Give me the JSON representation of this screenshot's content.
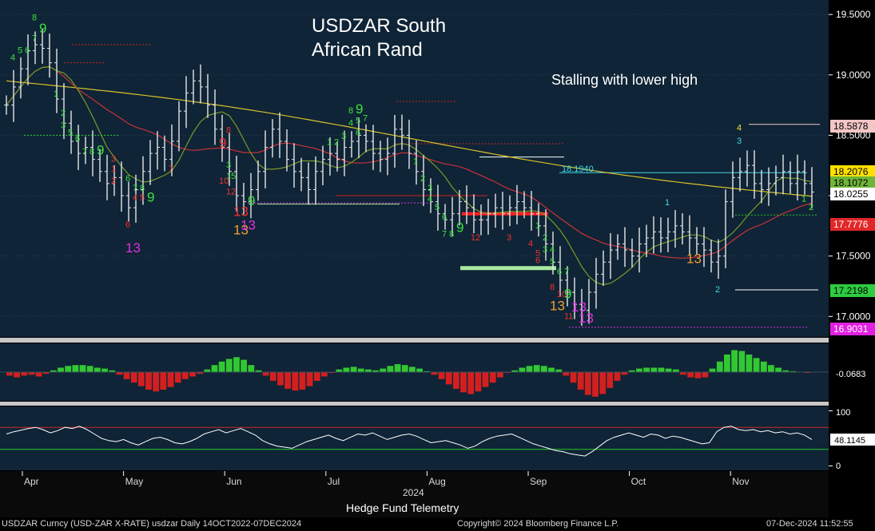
{
  "chart_data": {
    "type": "bar",
    "title": "USDZAR South African Rand",
    "title_lines": [
      "USDZAR South",
      "African Rand"
    ],
    "annotation": "Stalling with lower high",
    "price_level_label": "18.1940",
    "price_axis": {
      "ylim": [
        16.83,
        19.62
      ],
      "ticks": [
        "19.5000",
        "19.0000",
        "18.5000",
        "18.0000",
        "17.5000",
        "17.0000"
      ],
      "tick_values": [
        19.5,
        19.0,
        18.5,
        18.0,
        17.5,
        17.0
      ],
      "tags": [
        {
          "label": "18.5878",
          "value": 18.5878,
          "bg": "#f4c6c6",
          "fg": "#000000"
        },
        {
          "label": "18.2076",
          "value": 18.2076,
          "bg": "#ffe000",
          "fg": "#000000"
        },
        {
          "label": "18.1072",
          "value": 18.1072,
          "bg": "#6fb53a",
          "fg": "#000000"
        },
        {
          "label": "18.0255",
          "value": 18.0255,
          "bg": "#ffffff",
          "fg": "#000000"
        },
        {
          "label": "17.7776",
          "value": 17.7776,
          "bg": "#e02828",
          "fg": "#ffffff"
        },
        {
          "label": "17.2198",
          "value": 17.2198,
          "bg": "#2ecc40",
          "fg": "#000000"
        },
        {
          "label": "16.9031",
          "value": 16.9031,
          "bg": "#e020e0",
          "fg": "#ffffff"
        }
      ]
    },
    "macd": {
      "label": "-0.0683",
      "value": -0.0683,
      "histogram": [
        -0.04,
        -0.06,
        -0.04,
        -0.03,
        -0.05,
        -0.02,
        0.02,
        0.05,
        0.07,
        0.08,
        0.08,
        0.07,
        0.05,
        0.04,
        0.02,
        -0.03,
        -0.08,
        -0.12,
        -0.16,
        -0.2,
        -0.22,
        -0.2,
        -0.17,
        -0.12,
        -0.08,
        -0.05,
        -0.02,
        0.03,
        0.08,
        0.12,
        0.15,
        0.17,
        0.14,
        0.08,
        0.02,
        -0.04,
        -0.1,
        -0.15,
        -0.19,
        -0.21,
        -0.2,
        -0.16,
        -0.1,
        -0.05,
        -0.01,
        0.03,
        0.05,
        0.06,
        0.04,
        0.03,
        0.02,
        0.04,
        0.07,
        0.09,
        0.08,
        0.06,
        0.04,
        0.01,
        -0.03,
        -0.08,
        -0.14,
        -0.19,
        -0.23,
        -0.25,
        -0.22,
        -0.17,
        -0.12,
        -0.06,
        -0.01,
        0.02,
        0.05,
        0.07,
        0.08,
        0.07,
        0.05,
        0.03,
        -0.04,
        -0.12,
        -0.2,
        -0.26,
        -0.28,
        -0.25,
        -0.18,
        -0.1,
        -0.03,
        0.02,
        0.04,
        0.05,
        0.05,
        0.05,
        0.04,
        0.03,
        -0.03,
        -0.06,
        -0.07,
        -0.06,
        0.04,
        0.12,
        0.2,
        0.25,
        0.24,
        0.2,
        0.16,
        0.12,
        0.08,
        0.05,
        0.02,
        0.01,
        0.0,
        -0.01
      ]
    },
    "rsi": {
      "label": "48.1145",
      "value": 48.1145,
      "ylim": [
        -8,
        108
      ],
      "ticks": [
        "100",
        "0"
      ],
      "tick_values": [
        100,
        0
      ],
      "upper": 70,
      "lower": 30,
      "values": [
        58,
        62,
        65,
        68,
        70,
        66,
        60,
        64,
        70,
        68,
        72,
        66,
        58,
        50,
        46,
        44,
        48,
        42,
        38,
        44,
        50,
        52,
        48,
        42,
        40,
        44,
        50,
        58,
        62,
        66,
        60,
        64,
        68,
        62,
        56,
        46,
        40,
        36,
        34,
        32,
        38,
        44,
        48,
        52,
        56,
        50,
        46,
        52,
        58,
        56,
        60,
        54,
        48,
        52,
        56,
        58,
        54,
        48,
        42,
        44,
        46,
        42,
        38,
        32,
        36,
        44,
        50,
        54,
        56,
        58,
        52,
        46,
        40,
        36,
        32,
        28,
        26,
        22,
        20,
        18,
        26,
        36,
        46,
        52,
        56,
        60,
        56,
        52,
        58,
        56,
        50,
        54,
        52,
        48,
        44,
        40,
        42,
        62,
        70,
        72,
        66,
        64,
        66,
        62,
        64,
        60,
        62,
        58,
        60,
        56,
        48
      ]
    },
    "x_axis": {
      "months": [
        "Apr",
        "May",
        "Jun",
        "Jul",
        "Aug",
        "Sep",
        "Oct",
        "Nov"
      ],
      "year": "2024"
    },
    "colors": {
      "panel_bg": "#0f2436",
      "axis_bg": "#000000",
      "price_bars": "#e6e6e6",
      "ma_yellow": "#d8c12a",
      "ma_red": "#c8323a",
      "ma_green": "#7a9a2a",
      "macd_pos": "#32c832",
      "macd_neg": "#d22020",
      "rsi_line": "#ffffff",
      "rsi_upper": "#c82828",
      "rsi_lower": "#28c828",
      "count_green": "#3ee03e",
      "count_red": "#f03030",
      "count_orange": "#f0a030",
      "count_magenta": "#e030e0",
      "count_cyan": "#40d8e8",
      "count_yellow": "#f0e040"
    },
    "td_counts": [
      {
        "t": "8",
        "i": 4,
        "v": 19.45,
        "c": "green"
      },
      {
        "t": "9",
        "i": 5,
        "v": 19.35,
        "c": "green"
      },
      {
        "t": "7",
        "i": 4,
        "v": 19.28,
        "c": "green"
      },
      {
        "t": "6",
        "i": 3,
        "v": 19.18,
        "c": "green"
      },
      {
        "t": "5",
        "i": 2,
        "v": 19.18,
        "c": "green"
      },
      {
        "t": "4",
        "i": 1,
        "v": 19.12,
        "c": "green"
      },
      {
        "t": "1",
        "i": 7,
        "v": 18.82,
        "c": "green"
      },
      {
        "t": "2",
        "i": 8,
        "v": 18.66,
        "c": "green"
      },
      {
        "t": "3",
        "i": 8,
        "v": 18.56,
        "c": "green"
      },
      {
        "t": "5",
        "i": 9,
        "v": 18.5,
        "c": "green"
      },
      {
        "t": "6",
        "i": 10,
        "v": 18.45,
        "c": "green"
      },
      {
        "t": "7",
        "i": 11,
        "v": 18.34,
        "c": "green"
      },
      {
        "t": "8",
        "i": 12,
        "v": 18.34,
        "c": "green"
      },
      {
        "t": "9",
        "i": 13,
        "v": 18.34,
        "c": "green"
      },
      {
        "t": "3",
        "i": 15,
        "v": 18.28,
        "c": "red"
      },
      {
        "t": "1",
        "i": 15,
        "v": 18.2,
        "c": "red"
      },
      {
        "t": "2",
        "i": 15,
        "v": 18.1,
        "c": "red"
      },
      {
        "t": "6",
        "i": 17,
        "v": 18.12,
        "c": "green"
      },
      {
        "t": "7",
        "i": 18,
        "v": 18.04,
        "c": "green"
      },
      {
        "t": "8",
        "i": 19,
        "v": 18.04,
        "c": "green"
      },
      {
        "t": "9",
        "i": 20,
        "v": 17.95,
        "c": "green"
      },
      {
        "t": "4",
        "i": 18,
        "v": 17.96,
        "c": "red"
      },
      {
        "t": "5",
        "i": 19,
        "v": 17.96,
        "c": "red"
      },
      {
        "t": "6",
        "i": 17,
        "v": 17.74,
        "c": "red"
      },
      {
        "t": "13",
        "i": 17,
        "v": 17.53,
        "c": "magenta"
      },
      {
        "t": "7",
        "i": 23,
        "v": 18.2,
        "c": "red"
      },
      {
        "t": "9",
        "i": 30,
        "v": 18.4,
        "c": "red"
      },
      {
        "t": "8",
        "i": 31,
        "v": 18.52,
        "c": "red"
      },
      {
        "t": "3",
        "i": 31,
        "v": 18.23,
        "c": "green"
      },
      {
        "t": "15",
        "i": 31,
        "v": 18.14,
        "c": "green"
      },
      {
        "t": "10",
        "i": 30,
        "v": 18.1,
        "c": "red"
      },
      {
        "t": "12",
        "i": 31,
        "v": 18.01,
        "c": "red"
      },
      {
        "t": "13",
        "i": 32,
        "v": 17.83,
        "c": "red"
      },
      {
        "t": "9",
        "i": 34,
        "v": 17.92,
        "c": "green"
      },
      {
        "t": "13",
        "i": 32,
        "v": 17.68,
        "c": "orange"
      },
      {
        "t": "13",
        "i": 33,
        "v": 17.72,
        "c": "magenta"
      },
      {
        "t": "1",
        "i": 45,
        "v": 18.42,
        "c": "green"
      },
      {
        "t": "2",
        "i": 46,
        "v": 18.42,
        "c": "green"
      },
      {
        "t": "3",
        "i": 47,
        "v": 18.47,
        "c": "green"
      },
      {
        "t": "4",
        "i": 48,
        "v": 18.58,
        "c": "green"
      },
      {
        "t": "5",
        "i": 49,
        "v": 18.6,
        "c": "green"
      },
      {
        "t": "6",
        "i": 49,
        "v": 18.5,
        "c": "green"
      },
      {
        "t": "7",
        "i": 50,
        "v": 18.62,
        "c": "green"
      },
      {
        "t": "8",
        "i": 48,
        "v": 18.68,
        "c": "green"
      },
      {
        "t": "9",
        "i": 49,
        "v": 18.68,
        "c": "green"
      },
      {
        "t": "1",
        "i": 57,
        "v": 18.26,
        "c": "green"
      },
      {
        "t": "2",
        "i": 58,
        "v": 18.12,
        "c": "green"
      },
      {
        "t": "3",
        "i": 59,
        "v": 18.04,
        "c": "green"
      },
      {
        "t": "4",
        "i": 59,
        "v": 17.95,
        "c": "green"
      },
      {
        "t": "5",
        "i": 60,
        "v": 17.88,
        "c": "green"
      },
      {
        "t": "6",
        "i": 61,
        "v": 17.8,
        "c": "green"
      },
      {
        "t": "7",
        "i": 61,
        "v": 17.66,
        "c": "green"
      },
      {
        "t": "8",
        "i": 62,
        "v": 17.66,
        "c": "green"
      },
      {
        "t": "9",
        "i": 63,
        "v": 17.7,
        "c": "green"
      },
      {
        "t": "12",
        "i": 65,
        "v": 17.63,
        "c": "red"
      },
      {
        "t": "3",
        "i": 70,
        "v": 17.63,
        "c": "red"
      },
      {
        "t": "1",
        "i": 74,
        "v": 17.73,
        "c": "green"
      },
      {
        "t": "2",
        "i": 75,
        "v": 17.63,
        "c": "green"
      },
      {
        "t": "3",
        "i": 75,
        "v": 17.53,
        "c": "green"
      },
      {
        "t": "4",
        "i": 76,
        "v": 17.53,
        "c": "green"
      },
      {
        "t": "4",
        "i": 73,
        "v": 17.58,
        "c": "red"
      },
      {
        "t": "5",
        "i": 74,
        "v": 17.5,
        "c": "red"
      },
      {
        "t": "6",
        "i": 74,
        "v": 17.44,
        "c": "red"
      },
      {
        "t": "5",
        "i": 76,
        "v": 17.43,
        "c": "green"
      },
      {
        "t": "6",
        "i": 77,
        "v": 17.35,
        "c": "green"
      },
      {
        "t": "7",
        "i": 78,
        "v": 17.35,
        "c": "green"
      },
      {
        "t": "8",
        "i": 76,
        "v": 17.22,
        "c": "red"
      },
      {
        "t": "10",
        "i": 77,
        "v": 17.16,
        "c": "red"
      },
      {
        "t": "9",
        "i": 78,
        "v": 17.15,
        "c": "green"
      },
      {
        "t": "13",
        "i": 76,
        "v": 17.05,
        "c": "orange"
      },
      {
        "t": "11",
        "i": 78,
        "v": 16.98,
        "c": "red"
      },
      {
        "t": "13",
        "i": 79,
        "v": 17.04,
        "c": "magenta"
      },
      {
        "t": "13",
        "i": 80,
        "v": 16.95,
        "c": "magenta"
      },
      {
        "t": "1",
        "i": 92,
        "v": 17.92,
        "c": "cyan"
      },
      {
        "t": "13",
        "i": 95,
        "v": 17.44,
        "c": "orange"
      },
      {
        "t": "2",
        "i": 99,
        "v": 17.2,
        "c": "cyan"
      },
      {
        "t": "3",
        "i": 102,
        "v": 18.43,
        "c": "cyan"
      },
      {
        "t": "4",
        "i": 102,
        "v": 18.54,
        "c": "yellow"
      },
      {
        "t": "1",
        "i": 111,
        "v": 17.95,
        "c": "green"
      },
      {
        "t": "2",
        "i": 112,
        "v": 17.88,
        "c": "green"
      }
    ],
    "copyright": "Copyright© 2024 Bloomberg Finance L.P.",
    "footer_left": "USDZAR Curncy (USD-ZAR X-RATE) usdzar  Daily 14OCT2022-07DEC2024",
    "footer_right": "07-Dec-2024 11:52:55",
    "source": "Hedge Fund Telemetry",
    "close": [
      18.75,
      18.9,
      19.05,
      19.2,
      19.25,
      19.22,
      19.1,
      18.8,
      18.6,
      18.45,
      18.35,
      18.4,
      18.3,
      18.2,
      18.1,
      18.15,
      18.0,
      17.9,
      18.05,
      18.2,
      18.35,
      18.4,
      18.3,
      18.45,
      18.7,
      18.85,
      18.95,
      18.9,
      18.75,
      18.55,
      18.4,
      18.2,
      18.0,
      17.95,
      18.05,
      18.2,
      18.4,
      18.55,
      18.45,
      18.3,
      18.2,
      18.15,
      18.05,
      18.2,
      18.3,
      18.35,
      18.3,
      18.4,
      18.45,
      18.5,
      18.45,
      18.35,
      18.3,
      18.35,
      18.55,
      18.5,
      18.35,
      18.2,
      18.05,
      17.95,
      17.85,
      17.8,
      17.85,
      17.95,
      17.9,
      17.8,
      17.8,
      17.85,
      17.9,
      17.85,
      17.9,
      17.95,
      17.9,
      17.85,
      17.75,
      17.6,
      17.45,
      17.3,
      17.2,
      17.1,
      17.05,
      17.2,
      17.35,
      17.45,
      17.55,
      17.6,
      17.55,
      17.5,
      17.6,
      17.65,
      17.7,
      17.65,
      17.7,
      17.75,
      17.7,
      17.65,
      17.6,
      17.55,
      17.45,
      17.5,
      17.95,
      18.15,
      18.2,
      18.25,
      18.1,
      18.05,
      18.1,
      18.15,
      18.2,
      18.1,
      18.2,
      18.1,
      18.03
    ]
  }
}
